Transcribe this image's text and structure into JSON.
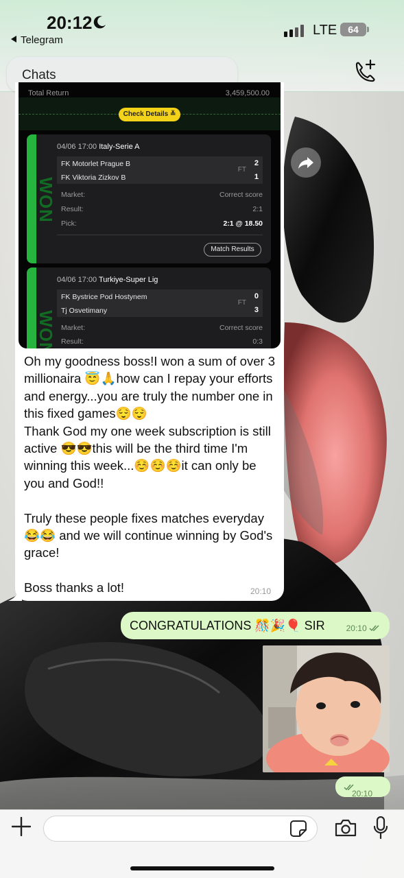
{
  "status": {
    "time": "20:12",
    "back_app": "Telegram",
    "network": "LTE",
    "battery": "64"
  },
  "header": {
    "search_label": "Chats"
  },
  "screenshot": {
    "total_label": "Total Return",
    "total_value": "3,459,500.00",
    "check_button": "Check Details ≚",
    "matches": [
      {
        "datetime": "04/06 17:00",
        "league": "Italy-Serie A",
        "team1": "FK Motorlet Prague B",
        "team2": "FK Viktoria Zizkov B",
        "score1": "2",
        "score2": "1",
        "ft": "FT",
        "market_label": "Market:",
        "market": "Correct score",
        "result_label": "Result:",
        "result": "2:1",
        "pick_label": "Pick:",
        "pick": "2:1 @ 18.50",
        "badge": "WON",
        "button": "Match Results"
      },
      {
        "datetime": "04/06 17:00",
        "league": "Turkiye-Super Lig",
        "team1": "FK Bystrice Pod Hostynem",
        "team2": "Tj Osvetimany",
        "score1": "0",
        "score2": "3",
        "ft": "FT",
        "market_label": "Market:",
        "market": "Correct score",
        "result_label": "Result:",
        "result": "0:3",
        "badge": "WON"
      }
    ]
  },
  "messages": {
    "incoming_text": "Oh my goodness boss!I won a sum of over 3 millionaira 😇🙏how can I repay your efforts and energy...you are truly the number one in this fixed games😌😌\nThank God my one week subscription is still active 😎😎this will be the third time I'm winning this week...☺️☺️☺️it can only be you and God!!\n\nTruly these people fixes matches everyday😂😂 and we will continue winning by God's grace!\n\nBoss thanks a lot!",
    "incoming_time": "20:10",
    "outgoing_text": "CONGRATULATIONS 🎊🎉🎈 SIR",
    "outgoing_time": "20:10",
    "photo_time": "20:10"
  },
  "colors": {
    "accent_green": "#27b43e",
    "bubble_out": "#dcf8c6",
    "check_yellow": "#f3d21a"
  },
  "icons": [
    "moon-icon",
    "signal-icon",
    "call-add-icon",
    "forward-icon",
    "read-check-icon",
    "plus-icon",
    "sticker-icon",
    "camera-icon",
    "mic-icon"
  ]
}
